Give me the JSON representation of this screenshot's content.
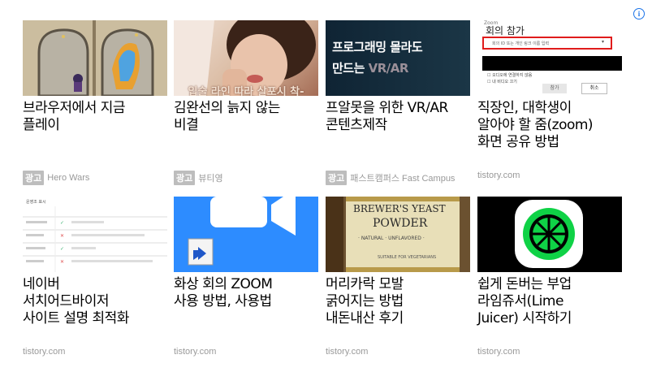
{
  "ad_info_icon": "i",
  "cards": [
    {
      "title": "브라우저에서 지금\n플레이",
      "badge": "광고",
      "source": "Hero Wars",
      "thumb": {
        "kind": "game"
      }
    },
    {
      "title": "김완선의 늙지 않는\n비결",
      "badge": "광고",
      "source": "뷰티영",
      "thumb": {
        "kind": "photo",
        "caption": "입술 라인 따라 살포시 착-"
      }
    },
    {
      "title": "프알못을 위한 VR/AR\n콘텐츠제작",
      "badge": "광고",
      "source": "패스트캠퍼스 Fast Campus",
      "thumb": {
        "kind": "banner",
        "line1": "프로그래밍 몰라도",
        "line2_prefix": "만드는",
        "line2_highlight": "VR/AR"
      }
    },
    {
      "title": "직장인, 대학생이\n알아야 할 줌(zoom)\n화면 공유 방법",
      "badge": "",
      "source": "tistory.com",
      "thumb": {
        "kind": "zoom-dialog",
        "app": "Zoom",
        "dialog_title": "회의 참가",
        "input_placeholder": "회의 ID 또는 개인 링크 이름 입력",
        "check1": "오디오에 연결하지 않음",
        "check2": "내 비디오 끄기",
        "join": "참가",
        "cancel": "취소"
      }
    },
    {
      "title": "네이버\n서치어드바이저\n사이트 설명 최적화",
      "badge": "",
      "source": "tistory.com",
      "thumb": {
        "kind": "doc",
        "heading": "운영조 표시"
      }
    },
    {
      "title": "화상 회의 ZOOM\n사용 방법, 사용법",
      "badge": "",
      "source": "tistory.com",
      "thumb": {
        "kind": "zoom-icon"
      }
    },
    {
      "title": "머리카락 모발\n굵어지는 방법\n내돈내산 후기",
      "badge": "",
      "source": "tistory.com",
      "thumb": {
        "kind": "bottle",
        "label1": "BREWER'S YEAST",
        "label2": "POWDER",
        "label3": "· NATURAL · UNFLAVORED ·",
        "label4": "SUITABLE FOR VEGETARIANS"
      }
    },
    {
      "title": "쉽게 돈버는 부업\n라임쥬서(Lime\nJuicer) 시작하기",
      "badge": "",
      "source": "tistory.com",
      "thumb": {
        "kind": "lime"
      }
    }
  ]
}
